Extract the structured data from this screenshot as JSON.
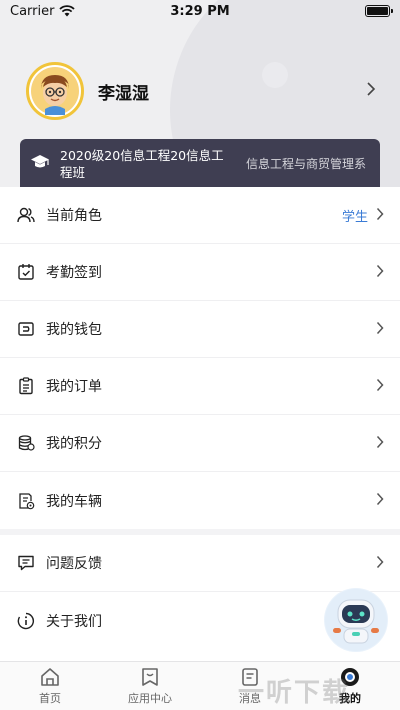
{
  "status_bar": {
    "carrier": "Carrier",
    "time": "3:29 PM"
  },
  "profile": {
    "name": "李湿湿"
  },
  "class_card": {
    "class_name": "2020级20信息工程20信息工程班",
    "department": "信息工程与商贸管理系"
  },
  "menu_group_1": [
    {
      "label": "当前角色",
      "value": "学生",
      "icon": "user-icon"
    },
    {
      "label": "考勤签到",
      "icon": "calendar-check-icon"
    },
    {
      "label": "我的钱包",
      "icon": "wallet-icon"
    },
    {
      "label": "我的订单",
      "icon": "clipboard-icon"
    },
    {
      "label": "我的积分",
      "icon": "coins-icon"
    },
    {
      "label": "我的车辆",
      "icon": "vehicle-doc-icon"
    }
  ],
  "menu_group_2": [
    {
      "label": "问题反馈",
      "icon": "feedback-icon"
    },
    {
      "label": "关于我们",
      "icon": "info-icon"
    }
  ],
  "tab_bar": {
    "tabs": [
      {
        "label": "首页",
        "icon": "home-icon"
      },
      {
        "label": "应用中心",
        "icon": "app-center-icon"
      },
      {
        "label": "消息",
        "icon": "message-icon"
      },
      {
        "label": "我的",
        "icon": "profile-icon",
        "active": true
      }
    ]
  },
  "watermark": {
    "text": "一听下载"
  },
  "colors": {
    "accent": "#3a7bd5",
    "card": "#3f3e52",
    "avatar_ring": "#f1c43a"
  }
}
